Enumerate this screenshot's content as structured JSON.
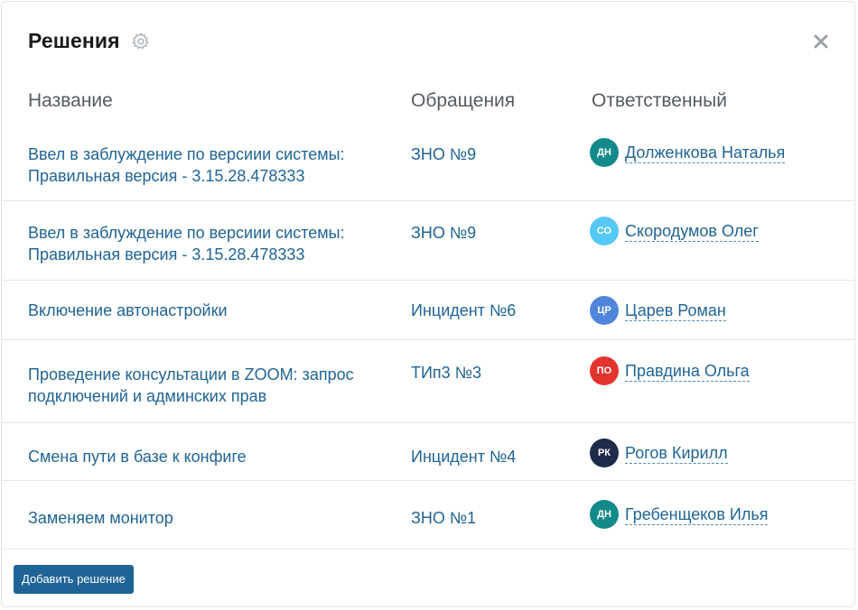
{
  "dialog": {
    "title": "Решения",
    "settings_icon": "gear-icon",
    "close_icon": "close-icon"
  },
  "columns": {
    "name": "Название",
    "requests": "Обращения",
    "responsible": "Ответственный"
  },
  "rows": [
    {
      "name": "Ввел в заблуждение по версиии системы: Правильная версия - 3.15.28.478333",
      "request": "ЗНО №9",
      "initials": "ДН",
      "avatar_color": "#138a8a",
      "person": "Долженкова Наталья"
    },
    {
      "name": "Ввел в заблуждение по версиии системы: Правильная версия - 3.15.28.478333",
      "request": "ЗНО №9",
      "initials": "СО",
      "avatar_color": "#55c8f5",
      "person": "Скородумов Олег"
    },
    {
      "name": "Включение автонастройки",
      "request": "Инцидент №6",
      "initials": "ЦР",
      "avatar_color": "#4f86dc",
      "person": "Царев Роман"
    },
    {
      "name": "Проведение консультации в ZOOM: запрос подключений и админских прав",
      "request": "ТИп3 №3",
      "initials": "ПО",
      "avatar_color": "#e3342f",
      "person": "Правдина Ольга"
    },
    {
      "name": "Смена пути в базе к конфиге",
      "request": "Инцидент №4",
      "initials": "РК",
      "avatar_color": "#1e2b4a",
      "person": "Рогов Кирилл"
    },
    {
      "name": "Заменяем монитор",
      "request": "ЗНО №1",
      "initials": "ДН",
      "avatar_color": "#138a8a",
      "person": "Гребенщеков Илья"
    }
  ],
  "footer": {
    "add_button": "Добавить решение"
  }
}
